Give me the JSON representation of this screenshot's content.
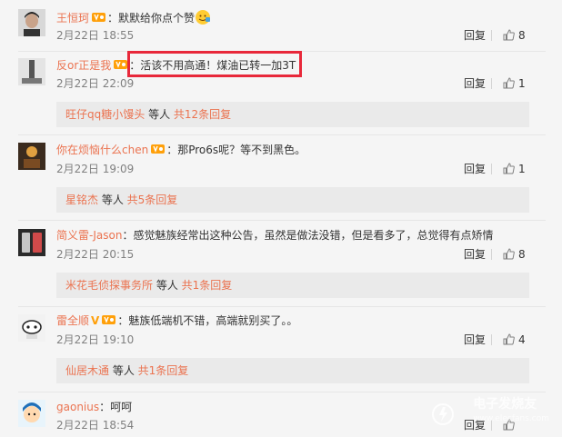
{
  "comments": [
    {
      "user": "王恒珂",
      "text": "：默默给你点个赞",
      "time": "2月22日 18:55",
      "reply": "回复",
      "likes": "8"
    },
    {
      "user": "反or正是我",
      "text": "：活该不用高通！煤油已转一加3T",
      "time": "2月22日 22:09",
      "reply": "回复",
      "likes": "1",
      "sub": {
        "name": "旺仔qq糖小馒头",
        "mid": " 等人 ",
        "count": "共12条回复"
      }
    },
    {
      "user": "你在烦恼什么chen",
      "text": "：那Pro6s呢？等不到黑色。",
      "time": "2月22日 19:09",
      "reply": "回复",
      "likes": "1",
      "sub": {
        "name": "星铭杰",
        "mid": " 等人 ",
        "count": "共5条回复"
      }
    },
    {
      "user": "简义雷-Jason",
      "text": "：感觉魅族经常出这种公告，虽然是做法没错，但是看多了，总觉得有点矫情",
      "time": "2月22日 20:15",
      "reply": "回复",
      "likes": "8",
      "sub": {
        "name": "米花毛侦探事务所",
        "mid": " 等人 ",
        "count": "共1条回复"
      }
    },
    {
      "user": "雷全顺",
      "text": "：魅族低端机不错，高端就别买了。。",
      "time": "2月22日 19:10",
      "reply": "回复",
      "likes": "4",
      "sub": {
        "name": "仙居木通",
        "mid": " 等人 ",
        "count": "共1条回复"
      }
    },
    {
      "user": "gaonius",
      "text": "：呵呵",
      "time": "2月22日 18:54",
      "reply": "回复",
      "likes": ""
    }
  ],
  "watermark": {
    "title": "电子发烧友",
    "url": "www.elecfans.com"
  },
  "colors": {
    "username": "#eb7350",
    "highlight": "#e8283a",
    "vip": "#ffa00a"
  }
}
